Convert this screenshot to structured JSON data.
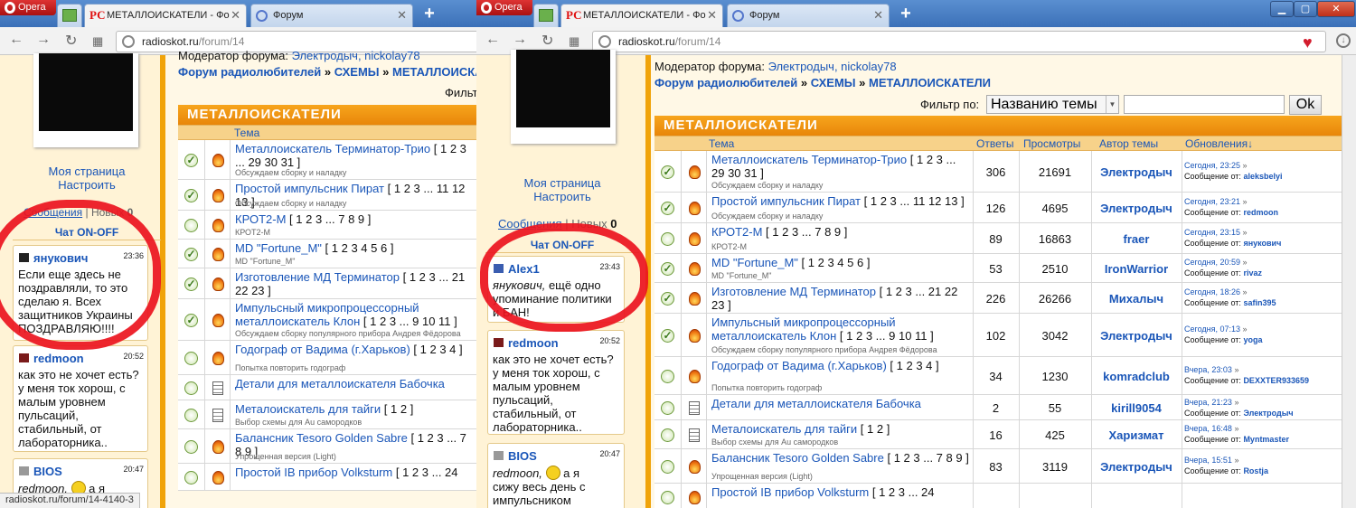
{
  "browser": {
    "app_label": "Opera",
    "tabs": [
      {
        "label": ""
      },
      {
        "label": "МЕТАЛЛОИСКАТЕЛИ - Фо"
      },
      {
        "label": "Форум"
      }
    ],
    "new_tab": "+",
    "url_host": "radioskot.ru",
    "url_path": "/forum/14",
    "status_url": "radioskot.ru/forum/14-4140-3"
  },
  "sidebar": {
    "my_page": "Моя страница",
    "configure": "Настроить",
    "messages": "Сообщения",
    "separator": "|",
    "new_label": "Новых",
    "new_count": "0",
    "chat_header": "Чат ON-OFF"
  },
  "chat_left": [
    {
      "user": "янукович",
      "time": "23:36",
      "text": "Если еще здесь не поздравляли, то это сделаю я. Всех защитников Украины ПОЗДРАВЛЯЮ!!!!"
    },
    {
      "user": "redmoon",
      "time": "20:52",
      "text": "как это не хочет есть? у меня ток хорош, с малым уровнем пульсаций, стабильный, от лабораторника.."
    },
    {
      "user": "BIOS",
      "time": "20:47",
      "text_a": "redmoon,",
      "text_b": " а я"
    }
  ],
  "chat_right": [
    {
      "user": "Alex1",
      "time": "23:43",
      "text_a": "янукович,",
      "text_b": " ещё одно упоминание политики и БАН!"
    },
    {
      "user": "redmoon",
      "time": "20:52",
      "text": "как это не хочет есть? у меня ток хорош, с малым уровнем пульсаций, стабильный, от лабораторника.."
    },
    {
      "user": "BIOS",
      "time": "20:47",
      "text_a": "redmoon,",
      "text_b": " а я",
      "text_c": "сижу весь день с",
      "text_d": "импульсником"
    }
  ],
  "forum": {
    "moderator_label": "Модератор форума:",
    "moderators": "Электродыч, nickolay78",
    "crumb1": "Форум радиолюбителей",
    "crumb2": "СХЕМЫ",
    "crumb3": "МЕТАЛЛОИСКАТЕЛИ",
    "crumb_sep": "»",
    "filter_label": "Фильтр по:",
    "filter_left_cut": "Фильт",
    "filter_value": "Названию темы",
    "ok": "Ok",
    "header": "МЕТАЛЛОИСКАТЕЛИ",
    "columns": {
      "topic": "Тема",
      "replies": "Ответы",
      "views": "Просмотры",
      "author": "Автор темы",
      "updates": "Обновления↓"
    },
    "update_by": "Сообщение от:",
    "rows": [
      {
        "title": "Металлоискатель Терминатор-Трио",
        "pages": "[ 1 2 3 ... 29 30 31 ]",
        "desc": "Обсуждаем сборку и наладку",
        "replies": "306",
        "views": "21691",
        "author": "Электродыч",
        "date": "Сегодня, 23:25",
        "by": "aleksbelyi"
      },
      {
        "title": "Простой импульсник Пират",
        "pages": "[ 1 2 3 ... 11 12 13 ]",
        "desc": "Обсуждаем сборку и наладку",
        "replies": "126",
        "views": "4695",
        "author": "Электродыч",
        "date": "Сегодня, 23:21",
        "by": "redmoon"
      },
      {
        "title": "КРОТ2-М",
        "pages": "[ 1 2 3 ... 7 8 9 ]",
        "desc": "КРОТ2-М",
        "replies": "89",
        "views": "16863",
        "author": "fraer",
        "date": "Сегодня, 23:15",
        "by": "янукович"
      },
      {
        "title": "MD \"Fortune_M\"",
        "pages": "[ 1 2 3 4 5 6 ]",
        "desc": "MD \"Fortune_M\"",
        "replies": "53",
        "views": "2510",
        "author": "IronWarrior",
        "date": "Сегодня, 20:59",
        "by": "rivaz"
      },
      {
        "title": "Изготовление МД Терминатор",
        "pages": "[ 1 2 3 ... 21 22 23 ]",
        "desc": "",
        "replies": "226",
        "views": "26266",
        "author": "Михалыч",
        "date": "Сегодня, 18:26",
        "by": "safin395"
      },
      {
        "title": "Импульсный микропроцессорный металлоискатель Клон",
        "pages": "[ 1 2 3 ... 9 10 11 ]",
        "desc": "Обсуждаем сборку популярного прибора Андрея Фёдорова",
        "replies": "102",
        "views": "3042",
        "author": "Электродыч",
        "date": "Сегодня, 07:13",
        "by": "yoga"
      },
      {
        "title": "Годограф от Вадима (г.Харьков)",
        "pages": "[ 1 2 3 4 ]",
        "desc": "Попытка повторить годограф",
        "replies": "34",
        "views": "1230",
        "author": "komradclub",
        "date": "Вчера, 23:03",
        "by": "DEXXTER933659"
      },
      {
        "title": "Детали для металлоискателя Бабочка",
        "pages": "",
        "desc": "",
        "replies": "2",
        "views": "55",
        "author": "kirill9054",
        "date": "Вчера, 21:23",
        "by": "Электродыч"
      },
      {
        "title": "Металоискатель для тайги",
        "pages": "[ 1 2 ]",
        "desc": "Выбор схемы для Au самородков",
        "replies": "16",
        "views": "425",
        "author": "Харизмат",
        "date": "Вчера, 16:48",
        "by": "Myntmaster"
      },
      {
        "title": "Балансник Tesoro Golden Sabre",
        "pages": "[ 1 2 3 ... 7 8 9 ]",
        "desc": "Упрощенная версия (Light)",
        "replies": "83",
        "views": "3119",
        "author": "Электродыч",
        "date": "Вчера, 15:51",
        "by": "Rostja"
      },
      {
        "title": "Простой IB прибор Volksturm",
        "pages": "[ 1 2 3 ... 24",
        "desc": "",
        "replies": "",
        "views": "",
        "author": "",
        "date": "",
        "by": ""
      }
    ]
  },
  "colors": {
    "accent": "#f0a30a",
    "link": "#1a56b8",
    "highlight": "#eb141e"
  }
}
